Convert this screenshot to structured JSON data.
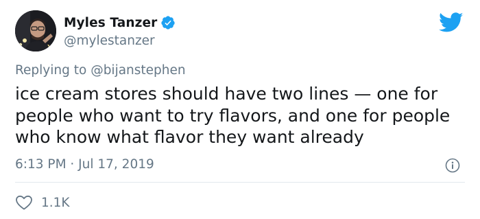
{
  "author": {
    "display_name": "Myles Tanzer",
    "handle": "@mylestanzer",
    "verified": true
  },
  "reply": {
    "prefix": "Replying to ",
    "mention": "@bijanstephen"
  },
  "tweet": {
    "text": "ice cream stores should have two lines — one for\npeople who want to try flavors, and one for people\nwho know what flavor they want already",
    "timestamp": "6:13 PM · Jul 17, 2019"
  },
  "engagement": {
    "like_count": "1.1K"
  },
  "icons": {
    "brand": "twitter-bird-icon",
    "verified": "verified-badge-icon",
    "info": "info-icon",
    "like": "heart-icon"
  },
  "colors": {
    "brand_blue": "#1da1f2",
    "text_primary": "#14171a",
    "text_secondary": "#657786",
    "divider": "#e1e8ed"
  }
}
